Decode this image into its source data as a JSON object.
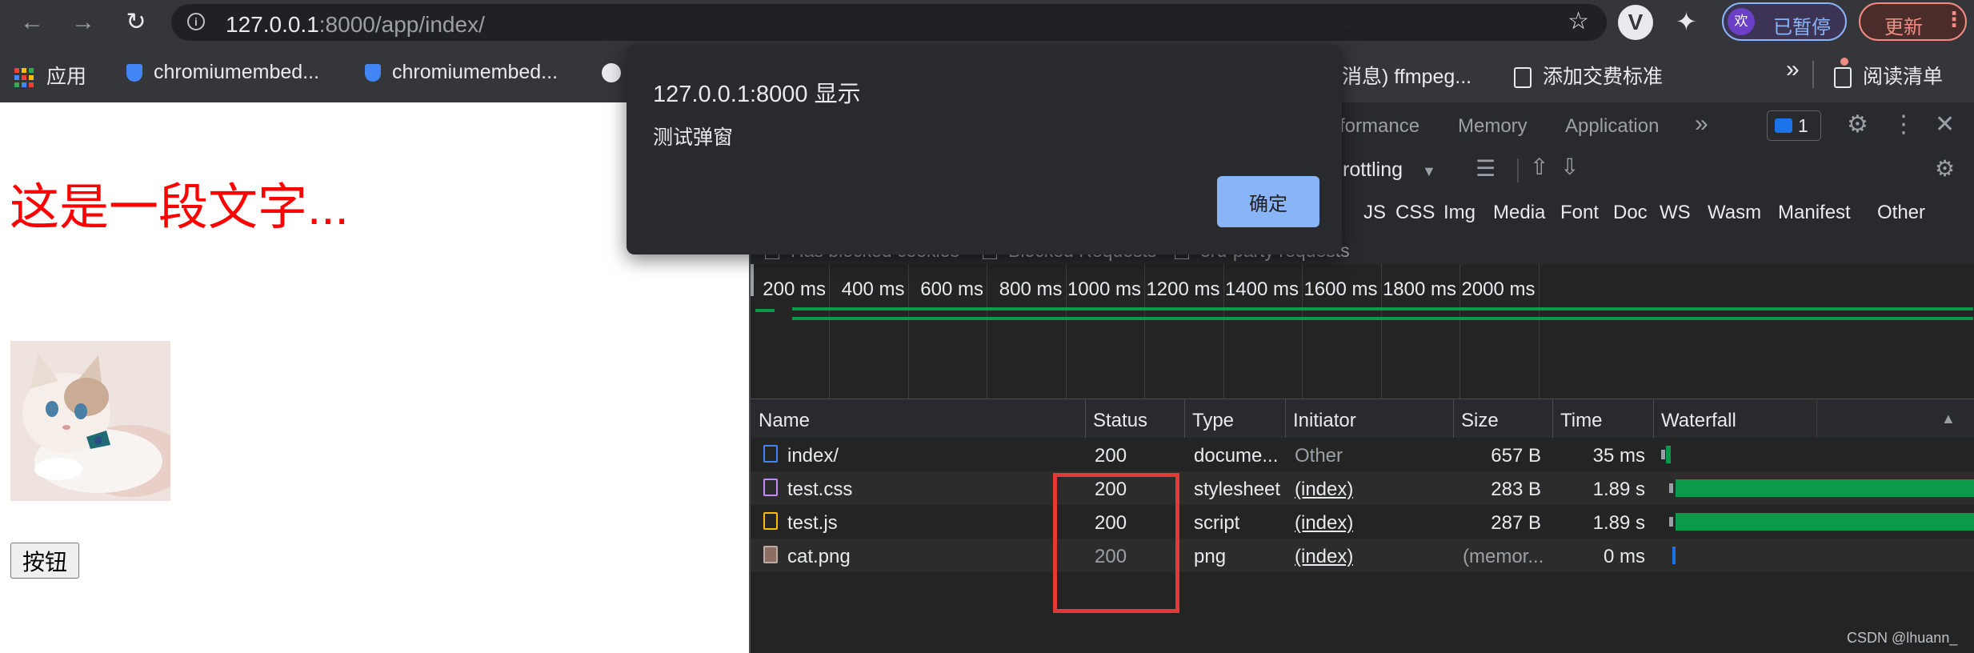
{
  "browser": {
    "url_host": "127.0.0.1",
    "url_rest": ":8000/app/index/",
    "profile_avatar": "欢",
    "profile_status": "已暂停",
    "update_label": "更新",
    "extension_letter": "V"
  },
  "bookmarks": {
    "apps": "应用",
    "items": [
      "chromiumembed...",
      "chromiumembed...",
      "条消息) ffmpeg...",
      "添加交费标准"
    ],
    "more": "»",
    "reading_list": "阅读清单"
  },
  "page": {
    "heading": "这是一段文字...",
    "button_label": "按钮",
    "heading_color": "#ff0000"
  },
  "alert": {
    "title": "127.0.0.1:8000 显示",
    "message": "测试弹窗",
    "ok_label": "确定"
  },
  "devtools": {
    "tabs": [
      "rformance",
      "Memory",
      "Application"
    ],
    "more_tabs": "»",
    "issues_count": "1",
    "throttling": "rottling",
    "filter_types": [
      "JS",
      "CSS",
      "Img",
      "Media",
      "Font",
      "Doc",
      "WS",
      "Wasm",
      "Manifest",
      "Other"
    ],
    "checkboxes": [
      "Has blocked cookies",
      "Blocked Requests",
      "3rd-party requests"
    ],
    "timeline_ticks": [
      "200 ms",
      "400 ms",
      "600 ms",
      "800 ms",
      "1000 ms",
      "1200 ms",
      "1400 ms",
      "1600 ms",
      "1800 ms",
      "2000 ms"
    ],
    "columns": [
      "Name",
      "Status",
      "Type",
      "Initiator",
      "Size",
      "Time",
      "Waterfall"
    ],
    "rows": [
      {
        "name": "index/",
        "status": "200",
        "type": "docume...",
        "initiator": "Other",
        "size": "657 B",
        "time": "35 ms",
        "icon": "document-icon"
      },
      {
        "name": "test.css",
        "status": "200",
        "type": "stylesheet",
        "initiator": "(index)",
        "size": "283 B",
        "time": "1.89 s",
        "icon": "stylesheet-icon"
      },
      {
        "name": "test.js",
        "status": "200",
        "type": "script",
        "initiator": "(index)",
        "size": "287 B",
        "time": "1.89 s",
        "icon": "script-icon"
      },
      {
        "name": "cat.png",
        "status": "200",
        "type": "png",
        "initiator": "(index)",
        "size": "(memor...",
        "time": "0 ms",
        "icon": "image-icon"
      }
    ],
    "watermark": "CSDN @lhuann_"
  }
}
